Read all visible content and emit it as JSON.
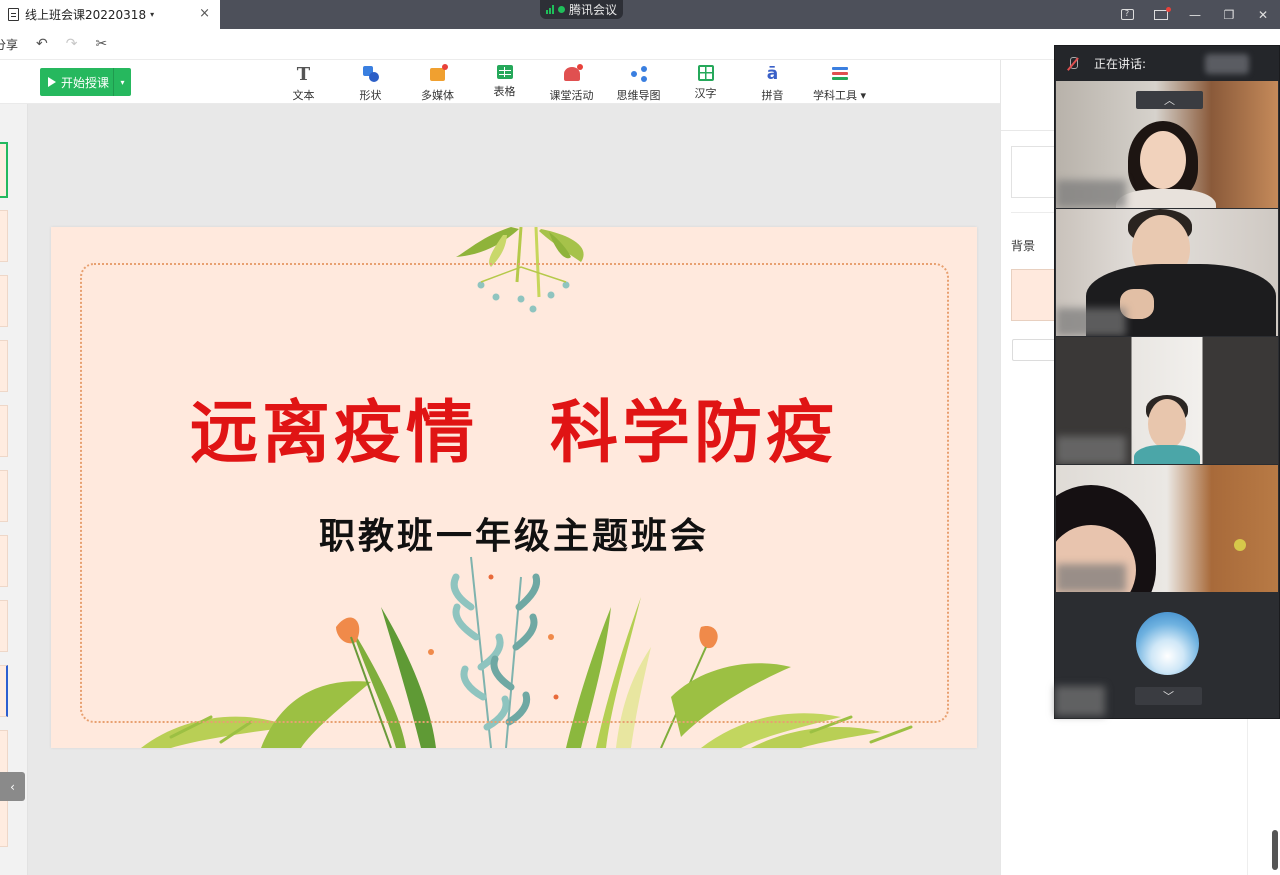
{
  "window": {
    "doc_tab_title": "线上班会课20220318",
    "doc_tab_caret": "▾",
    "doc_tab_close": "×",
    "meeting_app": "腾讯会议"
  },
  "titlebar_icons": {
    "feedback": "?",
    "minimize": "—",
    "restore": "❐",
    "close": "✕"
  },
  "quickbar": {
    "share": "分享",
    "undo": "↶",
    "redo": "↷",
    "cut": "✂"
  },
  "ribbon": {
    "start_button": "开始授课",
    "start_caret": "▾",
    "tools": [
      {
        "label": "文本",
        "icon": "text-icon"
      },
      {
        "label": "形状",
        "icon": "shape-icon"
      },
      {
        "label": "多媒体",
        "icon": "media-icon"
      },
      {
        "label": "表格",
        "icon": "table-icon"
      },
      {
        "label": "课堂活动",
        "icon": "activity-icon"
      },
      {
        "label": "思维导图",
        "icon": "mindmap-icon"
      },
      {
        "label": "汉字",
        "icon": "hanzi-icon"
      },
      {
        "label": "拼音",
        "icon": "pinyin-icon"
      },
      {
        "label": "学科工具 ▾",
        "icon": "subject-tools-icon"
      }
    ],
    "text_glyph": "T",
    "pinyin_glyph": "ā"
  },
  "slide": {
    "title": "远离疫情　科学防疫",
    "subtitle": "职教班一年级主题班会",
    "background_color": "#ffe9dd",
    "title_color": "#e01414"
  },
  "left_strip": {
    "collapse": "‹"
  },
  "right_panel": {
    "background_label": "背景"
  },
  "video_panel": {
    "speaking_label": "正在讲话:",
    "scroll_up": "︿",
    "scroll_down": "﹀"
  }
}
